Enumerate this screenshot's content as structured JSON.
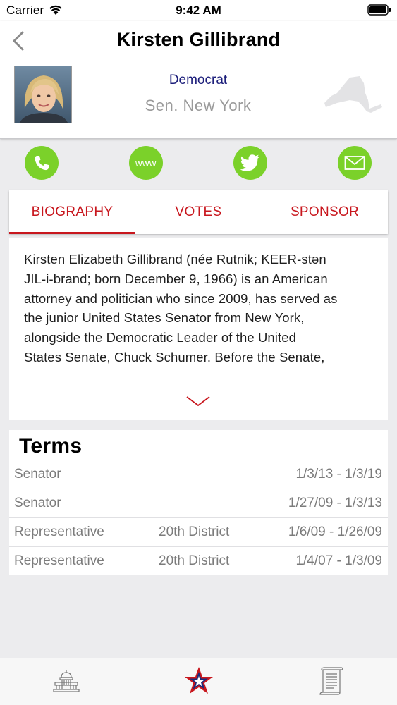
{
  "status_bar": {
    "carrier": "Carrier",
    "time": "9:42 AM"
  },
  "header": {
    "title": "Kirsten Gillibrand",
    "party": "Democrat",
    "seat": "Sen. New York",
    "party_color": "#1b1d7a"
  },
  "contact": {
    "www_label": "www",
    "accent_color": "#7bd12a",
    "icons": [
      "phone-icon",
      "www-icon",
      "twitter-icon",
      "mail-icon"
    ]
  },
  "tabs": {
    "items": [
      {
        "label": "BIOGRAPHY",
        "selected": true
      },
      {
        "label": "VOTES",
        "selected": false
      },
      {
        "label": "SPONSOR",
        "selected": false
      }
    ],
    "accent_color": "#c8171e"
  },
  "biography": {
    "lines": [
      "Kirsten Elizabeth Gillibrand (née Rutnik;  KEER-stən",
      "JIL-i-brand; born December 9, 1966) is an American",
      "attorney and politician who since 2009, has served as",
      "the junior United States Senator from New York,",
      "alongside the Democratic Leader of the United",
      "States Senate, Chuck Schumer. Before the Senate,"
    ]
  },
  "terms": {
    "title": "Terms",
    "rows": [
      {
        "role": "Senator",
        "district": "",
        "dates": "1/3/13 - 1/3/19"
      },
      {
        "role": "Senator",
        "district": "",
        "dates": "1/27/09 - 1/3/13"
      },
      {
        "role": "Representative",
        "district": "20th District",
        "dates": "1/6/09 - 1/26/09"
      },
      {
        "role": "Representative",
        "district": "20th District",
        "dates": "1/4/07 - 1/3/09"
      }
    ]
  },
  "tab_bar": {
    "items": [
      "capitol-icon",
      "star-icon",
      "document-icon"
    ]
  }
}
